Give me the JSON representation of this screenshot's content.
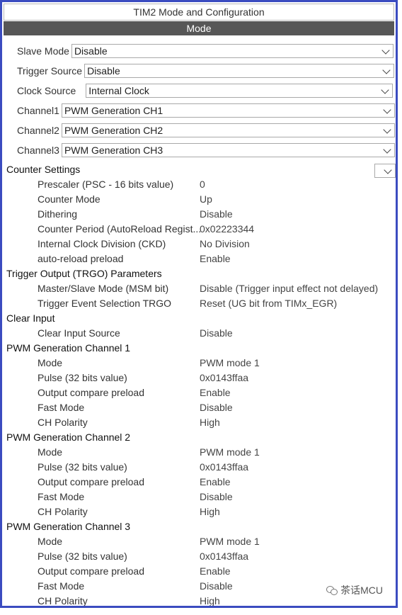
{
  "window": {
    "title": "TIM2 Mode and Configuration",
    "mode_header": "Mode"
  },
  "mode_fields": [
    {
      "label": "Slave Mode",
      "value": "Disable"
    },
    {
      "label": "Trigger Source",
      "value": "Disable"
    },
    {
      "label": "Clock Source",
      "value": "Internal Clock"
    },
    {
      "label": "Channel1",
      "value": "PWM Generation CH1"
    },
    {
      "label": "Channel2",
      "value": "PWM Generation CH2"
    },
    {
      "label": "Channel3",
      "value": "PWM Generation CH3"
    }
  ],
  "params": [
    {
      "group": "Counter Settings",
      "rows": [
        {
          "k": "Prescaler (PSC - 16 bits value)",
          "v": "0"
        },
        {
          "k": "Counter Mode",
          "v": "Up"
        },
        {
          "k": "Dithering",
          "v": "Disable"
        },
        {
          "k": "Counter Period (AutoReload Regist...",
          "v": "0x02223344"
        },
        {
          "k": "Internal Clock Division (CKD)",
          "v": "No Division"
        },
        {
          "k": "auto-reload preload",
          "v": "Enable"
        }
      ]
    },
    {
      "group": "Trigger Output (TRGO) Parameters",
      "rows": [
        {
          "k": "Master/Slave Mode (MSM bit)",
          "v": "Disable (Trigger input effect not delayed)"
        },
        {
          "k": "Trigger Event Selection TRGO",
          "v": "Reset (UG bit from TIMx_EGR)"
        }
      ]
    },
    {
      "group": "Clear Input",
      "rows": [
        {
          "k": "Clear Input Source",
          "v": "Disable"
        }
      ]
    },
    {
      "group": "PWM Generation Channel 1",
      "rows": [
        {
          "k": "Mode",
          "v": "PWM mode 1"
        },
        {
          "k": "Pulse (32 bits value)",
          "v": "0x0143ffaa"
        },
        {
          "k": "Output compare preload",
          "v": "Enable"
        },
        {
          "k": "Fast Mode",
          "v": "Disable"
        },
        {
          "k": "CH Polarity",
          "v": "High"
        }
      ]
    },
    {
      "group": "PWM Generation Channel 2",
      "rows": [
        {
          "k": "Mode",
          "v": "PWM mode 1"
        },
        {
          "k": "Pulse (32 bits value)",
          "v": "0x0143ffaa"
        },
        {
          "k": "Output compare preload",
          "v": "Enable"
        },
        {
          "k": "Fast Mode",
          "v": "Disable"
        },
        {
          "k": "CH Polarity",
          "v": "High"
        }
      ]
    },
    {
      "group": "PWM Generation Channel 3",
      "rows": [
        {
          "k": "Mode",
          "v": "PWM mode 1"
        },
        {
          "k": "Pulse (32 bits value)",
          "v": "0x0143ffaa"
        },
        {
          "k": "Output compare preload",
          "v": "Enable"
        },
        {
          "k": "Fast Mode",
          "v": "Disable"
        },
        {
          "k": "CH Polarity",
          "v": "High"
        }
      ]
    }
  ],
  "watermark": {
    "text": "茶话MCU",
    "icon": "wechat-icon"
  },
  "colors": {
    "frame": "#3b4cc0",
    "mode_bar": "#575757"
  }
}
